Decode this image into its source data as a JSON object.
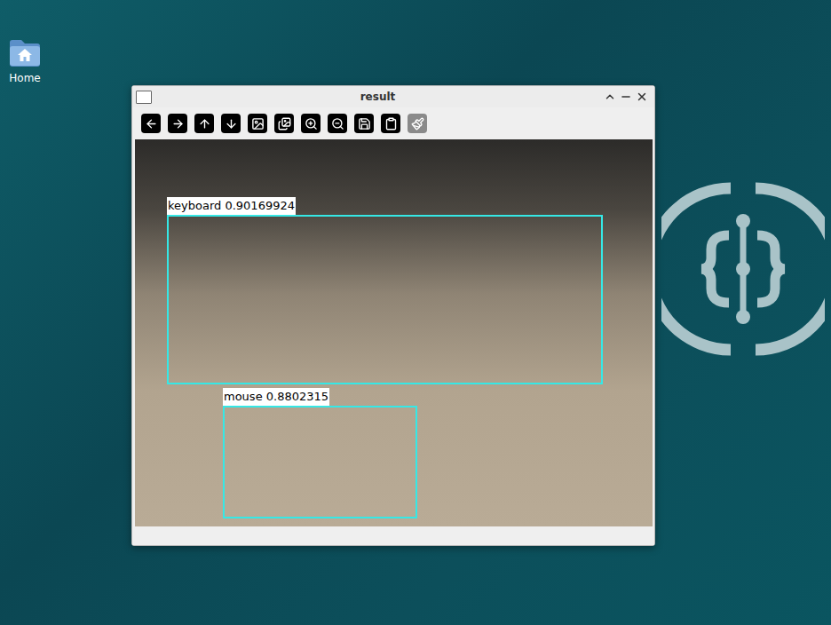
{
  "desktop": {
    "icons": [
      {
        "label": "Home"
      }
    ]
  },
  "window": {
    "title": "result",
    "toolbar": [
      {
        "disabled": false
      },
      {
        "disabled": false
      },
      {
        "disabled": false
      },
      {
        "disabled": false
      },
      {
        "disabled": false
      },
      {
        "disabled": false
      },
      {
        "disabled": false
      },
      {
        "disabled": false
      },
      {
        "disabled": false
      },
      {
        "disabled": false
      },
      {
        "disabled": true
      }
    ],
    "image": {
      "detections": [
        {
          "label": "keyboard 0.90169924"
        },
        {
          "label": "mouse 0.8802315"
        }
      ]
    }
  }
}
